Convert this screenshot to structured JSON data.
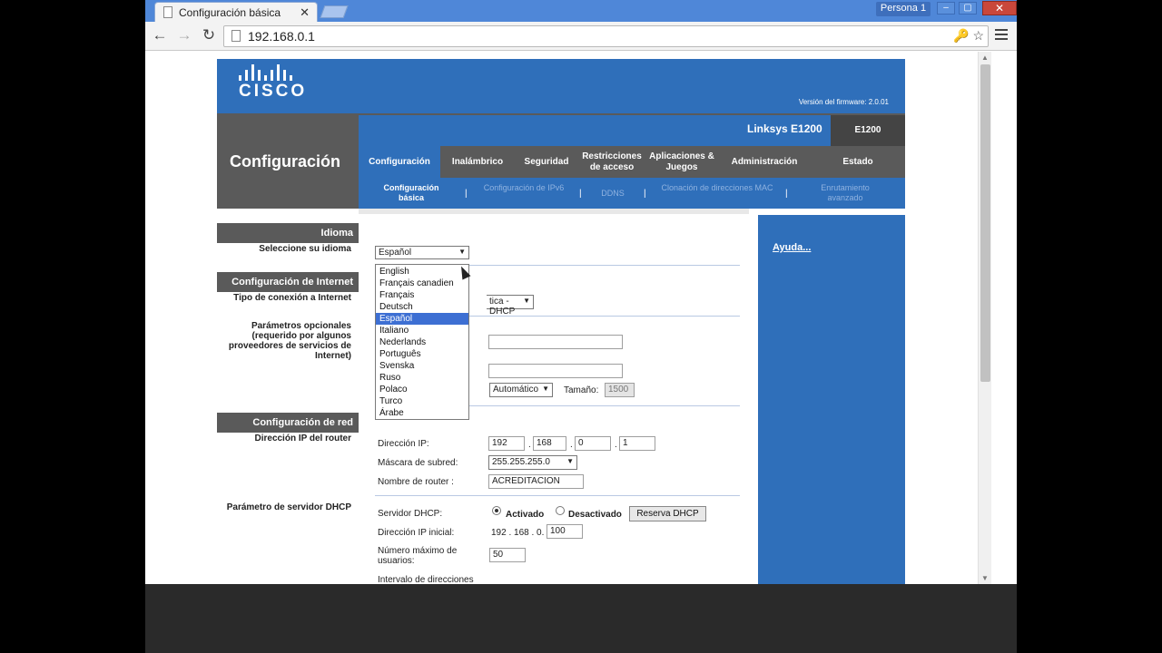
{
  "browser": {
    "tab_title": "Configuración básica",
    "tab_close": "✕",
    "persona": "Persona 1",
    "url": "192.168.0.1",
    "win_min": "–",
    "win_max": "▢",
    "win_close": "✕"
  },
  "router": {
    "logo_text": "CISCO",
    "firmware": "Versión del firmware: 2.0.01",
    "product": "Linksys E1200",
    "model": "E1200",
    "page_title": "Configuración",
    "menu": [
      "Configuración",
      "Inalámbrico",
      "Seguridad",
      "Restricciones de acceso",
      "Aplicaciones & Juegos",
      "Administración",
      "Estado"
    ],
    "submenu": [
      "Configuración básica",
      "Configuración de IPv6",
      "DDNS",
      "Clonación de direcciones MAC",
      "Enrutamiento avanzado"
    ],
    "sections": {
      "idioma": "Idioma",
      "seleccione": "Seleccione su idioma",
      "internet": "Configuración de Internet",
      "tipo_conexion": "Tipo de conexión a Internet",
      "opcionales": "Parámetros opcionales (requerido por algunos proveedores de servicios de Internet)",
      "red": "Configuración de red",
      "ip_router": "Dirección IP del router",
      "dhcp_param": "Parámetro de servidor DHCP"
    },
    "language_select": "Español",
    "language_options": [
      "English",
      "Français canadien",
      "Français",
      "Deutsch",
      "Español",
      "Italiano",
      "Nederlands",
      "Português",
      "Svenska",
      "Ruso",
      "Polaco",
      "Turco",
      "Árabe"
    ],
    "connection_type_partial": "tica - DHCP",
    "mtu_select": "Automático",
    "mtu_size_label": "Tamaño:",
    "mtu_size": "1500",
    "ip_label": "Dirección IP:",
    "ip": [
      "192",
      "168",
      "0",
      "1"
    ],
    "mask_label": "Máscara de subred:",
    "mask": "255.255.255.0",
    "router_name_label": "Nombre de router :",
    "router_name": "ACREDITACION",
    "dhcp_label": "Servidor DHCP:",
    "dhcp_on": "Activado",
    "dhcp_off": "Desactivado",
    "dhcp_reserve": "Reserva DHCP",
    "start_ip_label": "Dirección IP inicial:",
    "start_ip_prefix": "192 . 168 . 0.",
    "start_ip_last": "100",
    "max_users_label": "Número máximo de usuarios:",
    "max_users": "50",
    "range_label": "Intervalo de direcciones",
    "help": "Ayuda..."
  }
}
